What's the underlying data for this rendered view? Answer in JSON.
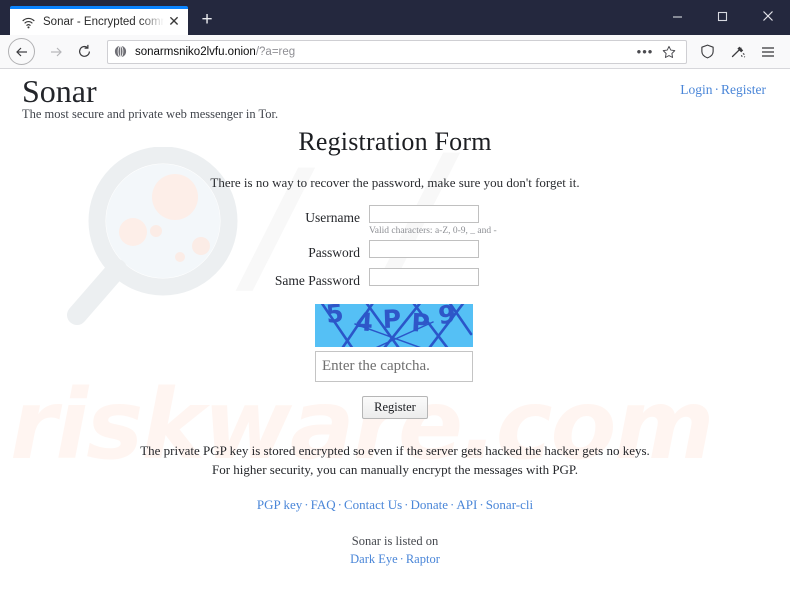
{
  "browser": {
    "tab": {
      "title": "Sonar - Encrypted communicat",
      "favicon": "sonar-wifi-icon",
      "close": "✕"
    },
    "new_tab_label": "+",
    "window_controls": {
      "minimize": "minimize-icon",
      "maximize": "maximize-icon",
      "close": "close-icon"
    },
    "nav": {
      "back": "back-arrow-icon",
      "forward": "forward-arrow-icon",
      "reload": "reload-icon"
    },
    "url": {
      "host": "sonarmsniko2lvfu.onion",
      "path": "/?a=reg",
      "site_icon": "onion-icon"
    },
    "url_actions": {
      "page_actions": "•••",
      "bookmark": "star-icon"
    },
    "toolbar_actions": {
      "shield": "shield-icon",
      "pocket": "pocket-icon",
      "menu": "hamburger-menu-icon"
    },
    "colors": {
      "chrome_dark": "#24283e",
      "tab_accent": "#0a84ff",
      "toolbar_bg": "#f9f9fa"
    }
  },
  "site": {
    "brand": "Sonar",
    "tagline": "The most secure and private web messenger in Tor.",
    "header_links": [
      {
        "label": "Login"
      },
      {
        "label": "Register"
      }
    ],
    "header_separator": "·"
  },
  "main": {
    "title": "Registration Form",
    "notice": "There is no way to recover the password, make sure you don't forget it.",
    "fields": [
      {
        "label": "Username",
        "value": "",
        "placeholder": "",
        "hint": "Valid characters: a-Z, 0-9, _ and -",
        "type": "text"
      },
      {
        "label": "Password",
        "value": "",
        "placeholder": "",
        "hint": "",
        "type": "password"
      },
      {
        "label": "Same Password",
        "value": "",
        "placeholder": "",
        "hint": "",
        "type": "password"
      }
    ],
    "captcha": {
      "text": "54PP9",
      "characters": [
        "5",
        "4",
        "P",
        "P",
        "9"
      ],
      "bg_color": "#55c0f5",
      "ink_color": "#2b56c9",
      "input_value": "",
      "input_placeholder": "Enter the captcha."
    },
    "submit_label": "Register"
  },
  "footer": {
    "line1": "The private PGP key is stored encrypted so even if the server gets hacked the hacker gets no keys.",
    "line2": "For higher security, you can manually encrypt the messages with PGP.",
    "links": [
      {
        "label": "PGP key"
      },
      {
        "label": "FAQ"
      },
      {
        "label": "Contact Us"
      },
      {
        "label": "Donate"
      },
      {
        "label": "API"
      },
      {
        "label": "Sonar-cli"
      }
    ],
    "separator": "·",
    "listed_label": "Sonar is listed on",
    "listed_links": [
      {
        "label": "Dark Eye"
      },
      {
        "label": "Raptor"
      }
    ]
  },
  "watermark": {
    "text": "riskware.com",
    "glass": "magnifier-watermark-icon"
  }
}
